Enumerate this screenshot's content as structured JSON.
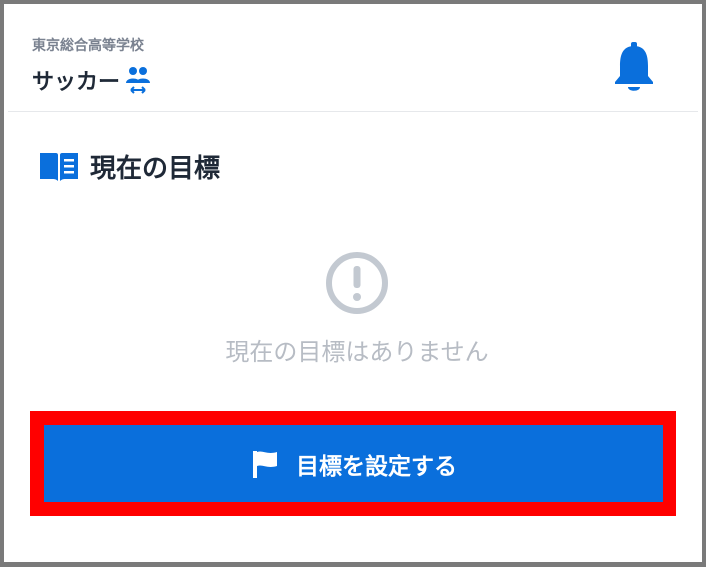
{
  "header": {
    "school_name": "東京総合高等学校",
    "club_name": "サッカー",
    "club_icon": "group-switch-icon",
    "notification_icon": "bell-icon"
  },
  "goal_section": {
    "title": "現在の目標",
    "title_icon": "book-icon",
    "empty_icon": "exclamation-circle-icon",
    "empty_message": "現在の目標はありません"
  },
  "actions": {
    "set_goal_label": "目標を設定する",
    "set_goal_icon": "flag-icon"
  },
  "colors": {
    "accent": "#0a6fdc",
    "highlight": "#ff0000",
    "muted": "#b7bcc4",
    "text": "#1f2937",
    "subtext": "#7a8290"
  }
}
